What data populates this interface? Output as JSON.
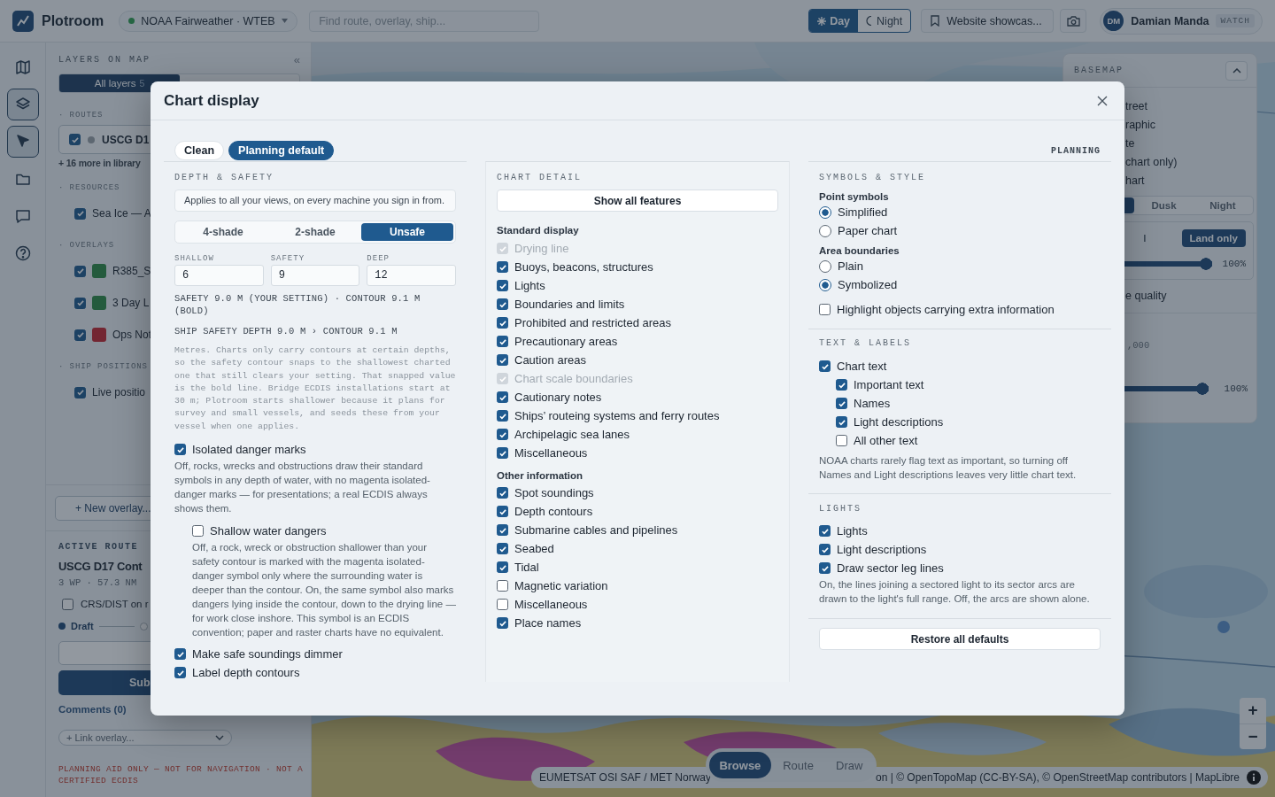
{
  "app": {
    "name": "Plotroom"
  },
  "top_bar": {
    "vessel": {
      "name": "NOAA Fairweather · WTEB",
      "online": true
    },
    "search": {
      "placeholder": "Find route, overlay, ship..."
    },
    "theme": [
      {
        "kind": "day",
        "label": "Day",
        "selected": true
      },
      {
        "kind": "night",
        "label": "Night",
        "selected": false
      }
    ],
    "bookmark": {
      "label": "Website showcas..."
    },
    "user": {
      "initials": "DM",
      "name": "Damian Manda",
      "role": "WATCH"
    }
  },
  "rail": [
    {
      "kind": "map",
      "selected": false
    },
    {
      "kind": "layers",
      "selected": true
    },
    {
      "kind": "pointer",
      "selected": true
    },
    {
      "kind": "folder",
      "selected": false
    },
    {
      "kind": "chat",
      "selected": false
    },
    {
      "kind": "help",
      "selected": false
    }
  ],
  "layers_panel": {
    "title": "LAYERS ON MAP",
    "collapse": "«",
    "tabs": [
      {
        "label": "All layers",
        "count": "5",
        "selected": true
      }
    ],
    "sections": [
      {
        "kind": "routes",
        "title": "· ROUTES",
        "items": [
          {
            "label": "USCG D1",
            "checked": true,
            "color": "#5d6771"
          }
        ],
        "more": "+ 16 more in library"
      },
      {
        "kind": "resources",
        "title": "· RESOURCES",
        "items": [
          {
            "label": "Sea Ice — A",
            "checked": true
          }
        ]
      },
      {
        "kind": "overlays",
        "title": "· OVERLAYS",
        "items": [
          {
            "label": "R385_S",
            "checked": true,
            "color": "#255b3d"
          },
          {
            "label": "3 Day L",
            "checked": true,
            "color": "#255b3d"
          },
          {
            "label": "Ops Not",
            "checked": true,
            "color": "#732732"
          }
        ]
      },
      {
        "kind": "ships",
        "title": "· SHIP POSITIONS",
        "items": [
          {
            "label": "Live positio",
            "checked": true
          }
        ]
      }
    ],
    "new_overlay": "+ New overlay...",
    "active_route": {
      "heading": "ACTIVE ROUTE",
      "name": "USCG D17 Cont",
      "summary": "3 WP · 57.3 NM",
      "crs_dist": {
        "label": "CRS/DIST on r",
        "checked": false
      },
      "status": {
        "label": "Draft"
      },
      "submit": "Sub",
      "comments": "Comments (0)",
      "link_overlay": "+ Link overlay..."
    },
    "disclaimer": "PLANNING AID ONLY — NOT FOR NAVIGATION · NOT A CERTIFIED ECDIS"
  },
  "map": {
    "kind": "picture",
    "basemap": {
      "title": "BASEMAP",
      "options": [
        "treet",
        "raphic",
        "te",
        "chart only)",
        "hart"
      ],
      "light_modes": [
        {
          "label": "Dusk",
          "selected": false
        },
        {
          "label": "Night",
          "selected": false
        }
      ],
      "land_filter": [
        {
          "label": "l",
          "selected": false
        },
        {
          "label": "Land only",
          "selected": true
        }
      ],
      "opacity": {
        "level": 1,
        "reading": "100%"
      },
      "quality": "e quality",
      "scale": ",000",
      "dimming": {
        "level": 1,
        "reading": "100%"
      }
    },
    "zoom": [
      "+",
      "−"
    ],
    "modes": [
      {
        "label": "Browse",
        "selected": true
      },
      {
        "label": "Route",
        "selected": false
      },
      {
        "label": "Draw",
        "selected": false
      }
    ],
    "attribution": [
      "EUMETSAT OSI SAF / MET Norway",
      "on | © OpenTopoMap (CC-BY-SA), © OpenStreetMap contributors | MapLibre"
    ]
  },
  "chart_display": {
    "title": "Chart display",
    "presets": [
      {
        "label": "Clean",
        "selected": false
      },
      {
        "label": "Planning default",
        "selected": true
      }
    ],
    "mode_label": "PLANNING",
    "depth": {
      "heading": "DEPTH & SAFETY",
      "note": "Applies to all your views, on every machine you sign in from.",
      "shading": [
        {
          "label": "4-shade",
          "selected": false
        },
        {
          "label": "2-shade",
          "selected": false
        },
        {
          "label": "Unsafe",
          "selected": true
        }
      ],
      "fields": [
        {
          "label": "SHALLOW",
          "value": "6"
        },
        {
          "label": "SAFETY",
          "value": "9"
        },
        {
          "label": "DEEP",
          "value": "12"
        }
      ],
      "summary": "SAFETY 9.0 M (YOUR SETTING) · CONTOUR 9.1 M (BOLD)",
      "ship_line": "SHIP SAFETY DEPTH 9.0 M › CONTOUR 9.1 M",
      "explanation": "Metres. Charts only carry contours at certain depths, so the safety contour snaps to the shallowest charted one that still clears your setting. That snapped value is the bold line. Bridge ECDIS installations start at 30 m; Plotroom starts shallower because it plans for survey and small vessels, and seeds these from your vessel when one applies.",
      "options": [
        {
          "label": "Isolated danger marks",
          "checked": true,
          "description": "Off, rocks, wrecks and obstructions draw their standard symbols in any depth of water, with no magenta isolated-danger marks — for presentations; a real ECDIS always shows them.",
          "children": [
            {
              "label": "Shallow water dangers",
              "checked": false,
              "description": "Off, a rock, wreck or obstruction shallower than your safety contour is marked with the magenta isolated-danger symbol only where the surrounding water is deeper than the contour. On, the same symbol also marks dangers lying inside the contour, down to the drying line — for work close inshore. This symbol is an ECDIS convention; paper and raster charts have no equivalent."
            }
          ]
        },
        {
          "label": "Make safe soundings dimmer",
          "checked": true
        },
        {
          "label": "Label depth contours",
          "checked": true
        }
      ]
    },
    "detail": {
      "heading": "CHART DETAIL",
      "show_all": "Show all features",
      "groups": [
        {
          "title": "Standard display",
          "items": [
            {
              "label": "Drying line",
              "checked": true,
              "disabled": true
            },
            {
              "label": "Buoys, beacons, structures",
              "checked": true,
              "disabled": false
            },
            {
              "label": "Lights",
              "checked": true,
              "disabled": false
            },
            {
              "label": "Boundaries and limits",
              "checked": true,
              "disabled": false
            },
            {
              "label": "Prohibited and restricted areas",
              "checked": true,
              "disabled": false
            },
            {
              "label": "Precautionary areas",
              "checked": true,
              "disabled": false
            },
            {
              "label": "Caution areas",
              "checked": true,
              "disabled": false
            },
            {
              "label": "Chart scale boundaries",
              "checked": true,
              "disabled": true
            },
            {
              "label": "Cautionary notes",
              "checked": true,
              "disabled": false
            },
            {
              "label": "Ships’ routeing systems and ferry routes",
              "checked": true,
              "disabled": false
            },
            {
              "label": "Archipelagic sea lanes",
              "checked": true,
              "disabled": false
            },
            {
              "label": "Miscellaneous",
              "checked": true,
              "disabled": false
            }
          ]
        },
        {
          "title": "Other information",
          "items": [
            {
              "label": "Spot soundings",
              "checked": true,
              "disabled": false
            },
            {
              "label": "Depth contours",
              "checked": true,
              "disabled": false
            },
            {
              "label": "Submarine cables and pipelines",
              "checked": true,
              "disabled": false
            },
            {
              "label": "Seabed",
              "checked": true,
              "disabled": false
            },
            {
              "label": "Tidal",
              "checked": true,
              "disabled": false
            },
            {
              "label": "Magnetic variation",
              "checked": false,
              "disabled": false
            },
            {
              "label": "Miscellaneous",
              "checked": false,
              "disabled": false
            },
            {
              "label": "Place names",
              "checked": true,
              "disabled": false
            }
          ]
        }
      ]
    },
    "symbols": {
      "heading": "SYMBOLS & STYLE",
      "groups": [
        {
          "title": "Point symbols",
          "options": [
            {
              "label": "Simplified",
              "selected": true
            },
            {
              "label": "Paper chart",
              "selected": false
            }
          ]
        },
        {
          "title": "Area boundaries",
          "options": [
            {
              "label": "Plain",
              "selected": false
            },
            {
              "label": "Symbolized",
              "selected": true
            }
          ]
        }
      ],
      "highlight": {
        "label": "Highlight objects carrying extra information",
        "checked": false
      }
    },
    "text_labels": {
      "heading": "TEXT & LABELS",
      "items": [
        {
          "label": "Chart text",
          "checked": true,
          "children": [
            {
              "label": "Important text",
              "checked": true
            },
            {
              "label": "Names",
              "checked": true
            },
            {
              "label": "Light descriptions",
              "checked": true
            },
            {
              "label": "All other text",
              "checked": false
            }
          ]
        }
      ],
      "note": "NOAA charts rarely flag text as important, so turning off Names and Light descriptions leaves very little chart text."
    },
    "lights": {
      "heading": "LIGHTS",
      "items": [
        {
          "label": "Lights",
          "checked": true
        },
        {
          "label": "Light descriptions",
          "checked": true
        },
        {
          "label": "Draw sector leg lines",
          "checked": true
        }
      ],
      "note": "On, the lines joining a sectored light to its sector arcs are drawn to the light's full range. Off, the arcs are shown alone."
    },
    "restore": "Restore all defaults"
  }
}
